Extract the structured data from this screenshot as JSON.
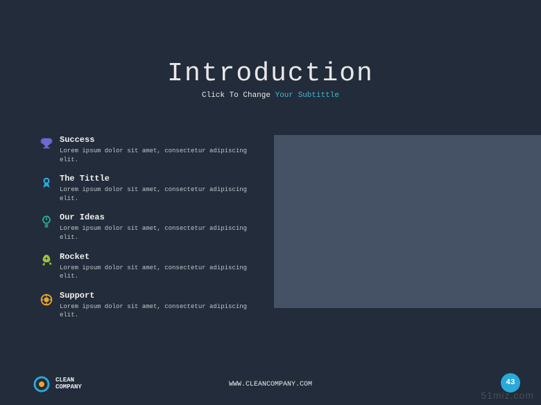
{
  "header": {
    "title": "Introduction",
    "subtitle_prefix": "Click To Change ",
    "subtitle_accent": "Your Subtittle"
  },
  "items": [
    {
      "icon": "trophy",
      "color": "#6b6bd6",
      "title": "Success",
      "desc": "Lorem ipsum dolor sit amet, consectetur adipiscing elit."
    },
    {
      "icon": "ribbon",
      "color": "#2aa8d8",
      "title": "The Tittle",
      "desc": "Lorem ipsum dolor sit amet, consectetur adipiscing elit."
    },
    {
      "icon": "bulb",
      "color": "#28b89a",
      "title": "Our Ideas",
      "desc": "Lorem ipsum dolor sit amet, consectetur adipiscing elit."
    },
    {
      "icon": "rocket",
      "color": "#9ac23c",
      "title": "Rocket",
      "desc": "Lorem ipsum dolor sit amet, consectetur adipiscing elit."
    },
    {
      "icon": "support",
      "color": "#e8a62e",
      "title": "Support",
      "desc": "Lorem ipsum dolor sit amet, consectetur adipiscing elit."
    }
  ],
  "footer": {
    "brand_line1": "CLEAN",
    "brand_line2": "COMPANY",
    "url": "WWW.CLEANCOMPANY.COM",
    "page": "43"
  },
  "watermark": "51miz.com"
}
